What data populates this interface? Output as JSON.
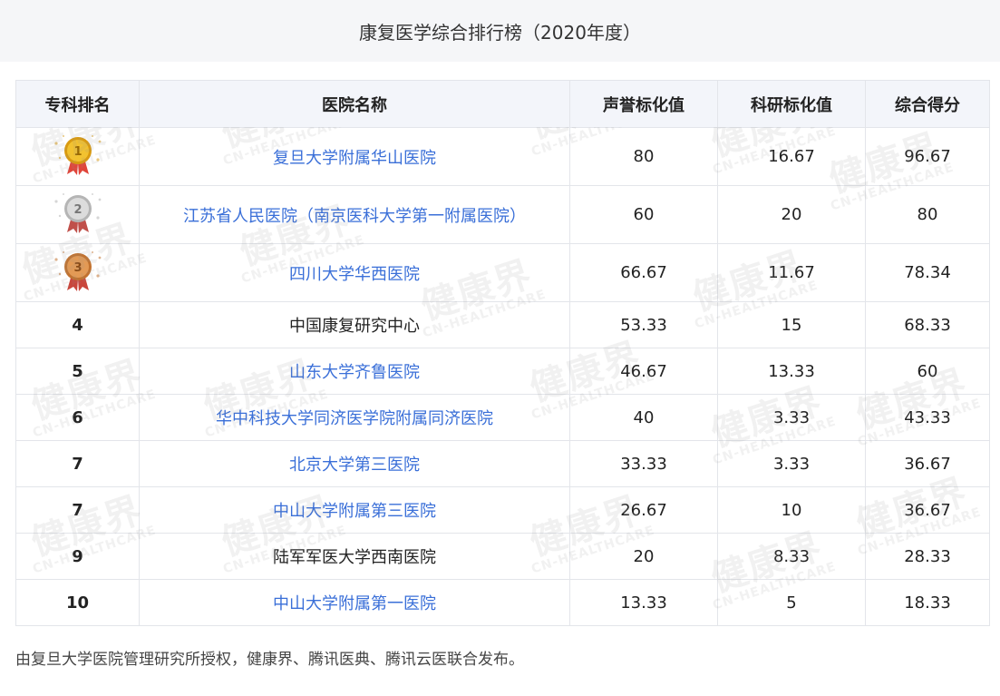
{
  "page_title": "康复医学综合排行榜（2020年度）",
  "table": {
    "headers": [
      "专科排名",
      "医院名称",
      "声誉标化值",
      "科研标化值",
      "综合得分"
    ],
    "rows": [
      {
        "rank": "1",
        "medal": "gold-medal-icon",
        "hospital": "复旦大学附属华山医院",
        "link": true,
        "reputation": "80",
        "research": "16.67",
        "total": "96.67"
      },
      {
        "rank": "2",
        "medal": "silver-medal-icon",
        "hospital": "江苏省人民医院（南京医科大学第一附属医院）",
        "link": true,
        "reputation": "60",
        "research": "20",
        "total": "80"
      },
      {
        "rank": "3",
        "medal": "bronze-medal-icon",
        "hospital": "四川大学华西医院",
        "link": true,
        "reputation": "66.67",
        "research": "11.67",
        "total": "78.34"
      },
      {
        "rank": "4",
        "hospital": "中国康复研究中心",
        "link": false,
        "reputation": "53.33",
        "research": "15",
        "total": "68.33"
      },
      {
        "rank": "5",
        "hospital": "山东大学齐鲁医院",
        "link": true,
        "reputation": "46.67",
        "research": "13.33",
        "total": "60"
      },
      {
        "rank": "6",
        "hospital": "华中科技大学同济医学院附属同济医院",
        "link": true,
        "reputation": "40",
        "research": "3.33",
        "total": "43.33"
      },
      {
        "rank": "7",
        "hospital": "北京大学第三医院",
        "link": true,
        "reputation": "33.33",
        "research": "3.33",
        "total": "36.67"
      },
      {
        "rank": "7",
        "hospital": "中山大学附属第三医院",
        "link": true,
        "reputation": "26.67",
        "research": "10",
        "total": "36.67"
      },
      {
        "rank": "9",
        "hospital": "陆军军医大学西南医院",
        "link": false,
        "reputation": "20",
        "research": "8.33",
        "total": "28.33"
      },
      {
        "rank": "10",
        "hospital": "中山大学附属第一医院",
        "link": true,
        "reputation": "13.33",
        "research": "5",
        "total": "18.33"
      }
    ]
  },
  "watermark": {
    "main": "健康界",
    "sub": "CN-HEALTHCARE"
  },
  "footer_text": "由复旦大学医院管理研究所授权，健康界、腾讯医典、腾讯云医联合发布。",
  "colors": {
    "link": "#3a6fd8",
    "gold": "#e8b21f",
    "silver": "#c9c9c9",
    "bronze": "#d9853f",
    "header_bg": "#f3f5fa"
  }
}
